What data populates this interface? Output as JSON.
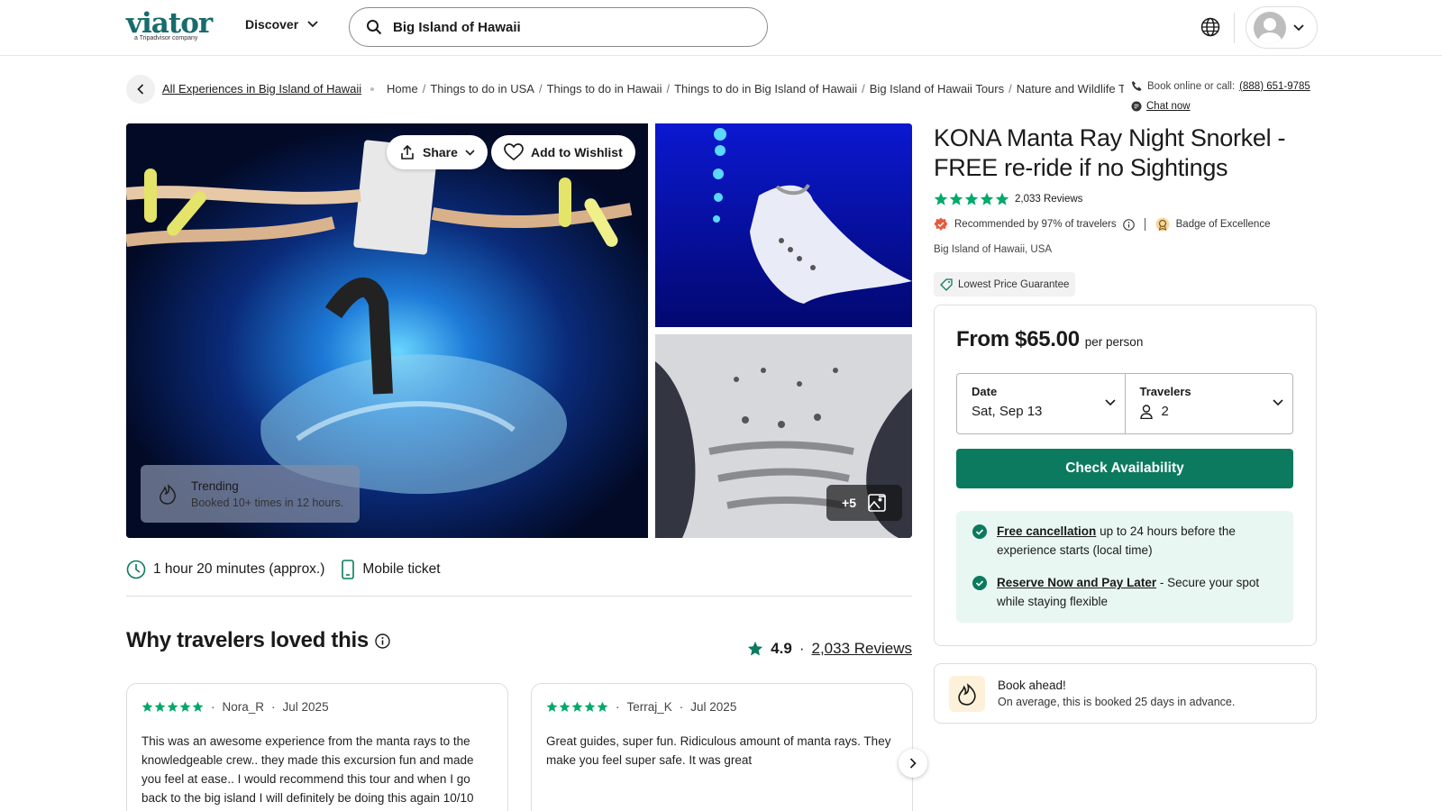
{
  "header": {
    "logo_text": "viator",
    "logo_sub": "a Tripadvisor company",
    "discover_label": "Discover",
    "search_value": "Big Island of Hawaii"
  },
  "breadcrumb": {
    "all_experiences": "All Experiences in Big Island of Hawaii",
    "items": [
      "Home",
      "Things to do in USA",
      "Things to do in Hawaii",
      "Things to do in Big Island of Hawaii",
      "Big Island of Hawaii Tours",
      "Nature and Wildlife Tours"
    ]
  },
  "contact": {
    "book_label": "Book online or call:",
    "phone": "(888) 651-9785",
    "chat": "Chat now"
  },
  "gallery": {
    "share_label": "Share",
    "wishlist_label": "Add to Wishlist",
    "trending_title": "Trending",
    "trending_sub": "Booked 10+ times in 12 hours.",
    "more_photos": "+5"
  },
  "features": {
    "duration": "1 hour 20 minutes (approx.)",
    "ticket": "Mobile ticket"
  },
  "reviews_section": {
    "title": "Why travelers loved this",
    "rating": "4.9",
    "review_count": "2,033 Reviews",
    "reviews": [
      {
        "author": "Nora_R",
        "date": "Jul 2025",
        "rating": 5,
        "text": "This was an awesome experience from the manta rays to the knowledgeable crew.. they made this excursion fun and made you feel at ease.. I would recommend this tour and when I go back to the big island I will definitely be doing this again 10/10"
      },
      {
        "author": "Terraj_K",
        "date": "Jul 2025",
        "rating": 5,
        "text": "Great guides, super fun. Ridiculous amount of manta rays. They make you feel super safe. It was great"
      }
    ]
  },
  "product": {
    "title": "KONA Manta Ray Night Snorkel - FREE re-ride if no Sightings",
    "rating": 5,
    "reviews": "2,033 Reviews",
    "recommended": "Recommended by 97% of travelers",
    "badge": "Badge of Excellence",
    "location": "Big Island of Hawaii, USA",
    "price_guarantee": "Lowest Price Guarantee"
  },
  "booking": {
    "price": "From $65.00",
    "per": "per person",
    "date_label": "Date",
    "date_value": "Sat, Sep 13",
    "travelers_label": "Travelers",
    "travelers_value": "2",
    "cta": "Check Availability",
    "cancel_link": "Free cancellation",
    "cancel_text": "up to 24 hours before the experience starts (local time)",
    "reserve_link": "Reserve Now and Pay Later",
    "reserve_text": "- Secure your spot while staying flexible"
  },
  "book_ahead": {
    "title": "Book ahead!",
    "sub": "On average, this is booked 25 days in advance."
  },
  "colors": {
    "brand": "#186b6d",
    "cta": "#0b7a5e",
    "stars": "#00aa6c",
    "perks_bg": "#e9f7f3"
  }
}
